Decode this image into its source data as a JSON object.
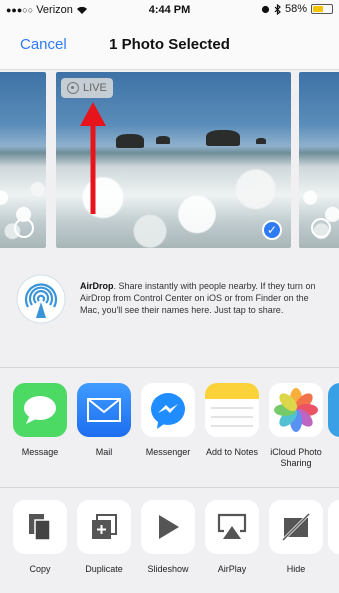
{
  "status_bar": {
    "carrier": "Verizon",
    "time": "4:44 PM",
    "battery_percent": "58%",
    "battery_level": 0.58
  },
  "nav": {
    "cancel_label": "Cancel",
    "title": "1 Photo Selected"
  },
  "photo": {
    "live_label": "LIVE"
  },
  "airdrop": {
    "title": "AirDrop",
    "description": ". Share instantly with people nearby. If they turn on AirDrop from Control Center on iOS or from Finder on the Mac, you'll see their names here. Just tap to share."
  },
  "share_apps": [
    {
      "label": "Message",
      "icon": "message-icon",
      "color": "#4cd964"
    },
    {
      "label": "Mail",
      "icon": "mail-icon",
      "color": "#2d7ff9"
    },
    {
      "label": "Messenger",
      "icon": "messenger-icon",
      "color": "#ffffff"
    },
    {
      "label": "Add to Notes",
      "icon": "notes-icon",
      "color": "#ffffff"
    },
    {
      "label": "iCloud Photo Sharing",
      "icon": "photos-icon",
      "color": "#ffffff"
    }
  ],
  "actions": [
    {
      "label": "Copy",
      "icon": "copy-icon"
    },
    {
      "label": "Duplicate",
      "icon": "duplicate-icon"
    },
    {
      "label": "Slideshow",
      "icon": "slideshow-icon"
    },
    {
      "label": "AirPlay",
      "icon": "airplay-icon"
    },
    {
      "label": "Hide",
      "icon": "hide-icon"
    }
  ],
  "colors": {
    "accent": "#2f7bf6",
    "annotation_arrow": "#e8141c"
  }
}
